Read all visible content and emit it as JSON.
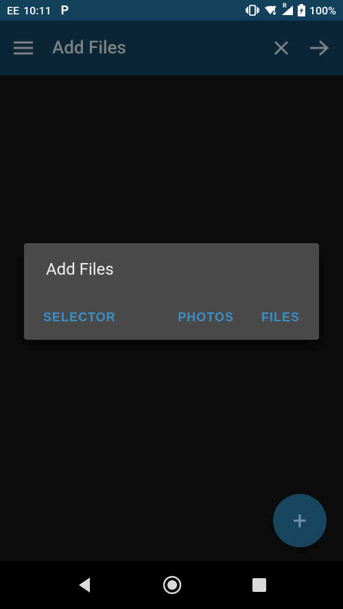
{
  "status": {
    "carrier": "EE",
    "time": "10:11",
    "battery": "100%",
    "roaming": "R"
  },
  "appbar": {
    "title": "Add Files"
  },
  "dialog": {
    "title": "Add Files",
    "selector_label": "SELECTOR",
    "photos_label": "PHOTOS",
    "files_label": "FILES"
  },
  "fab": {
    "icon_text": "+"
  }
}
